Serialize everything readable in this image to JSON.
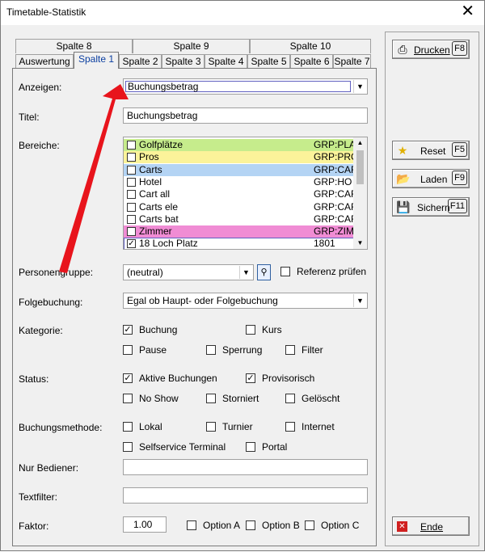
{
  "window": {
    "title": "Timetable-Statistik",
    "close_symbol": "✕"
  },
  "tabs_row1": [
    "Spalte 8",
    "Spalte 9",
    "Spalte 10"
  ],
  "tabs_row2": [
    "Auswertung",
    "Spalte 1",
    "Spalte 2",
    "Spalte 3",
    "Spalte 4",
    "Spalte 5",
    "Spalte 6",
    "Spalte 7"
  ],
  "form": {
    "anzeigen_label": "Anzeigen:",
    "anzeigen_value": "Buchungsbetrag",
    "titel_label": "Titel:",
    "titel_value": "Buchungsbetrag",
    "bereiche_label": "Bereiche:",
    "personengruppe_label": "Personengruppe:",
    "personengruppe_value": "(neutral)",
    "referenz_label": "Referenz prüfen",
    "folgebuchung_label": "Folgebuchung:",
    "folgebuchung_value": "Egal ob Haupt- oder Folgebuchung",
    "kategorie_label": "Kategorie:",
    "status_label": "Status:",
    "buchungsmethode_label": "Buchungsmethode:",
    "nur_bediener_label": "Nur Bediener:",
    "nur_bediener_value": "",
    "textfilter_label": "Textfilter:",
    "textfilter_value": "",
    "faktor_label": "Faktor:",
    "faktor_value": "1.00"
  },
  "bereiche": [
    {
      "name": "Golfplätze",
      "code": "GRP:PLA",
      "checked": false,
      "color": "#c6ec8c"
    },
    {
      "name": "Pros",
      "code": "GRP:PRO",
      "checked": false,
      "color": "#fbf39a"
    },
    {
      "name": "Carts",
      "code": "GRP:CAR",
      "checked": false,
      "color": "#b4d4f4"
    },
    {
      "name": "Hotel",
      "code": "GRP:HO",
      "checked": false,
      "color": "#ffffff"
    },
    {
      "name": "Cart all",
      "code": "GRP:CAR",
      "checked": false,
      "color": "#ffffff"
    },
    {
      "name": "Carts ele",
      "code": "GRP:CAR",
      "checked": false,
      "color": "#ffffff"
    },
    {
      "name": "Carts bat",
      "code": "GRP:CAR",
      "checked": false,
      "color": "#ffffff"
    },
    {
      "name": "Zimmer",
      "code": "GRP:ZIM",
      "checked": false,
      "color": "#f08cd4"
    },
    {
      "name": "18 Loch Platz",
      "code": "1801",
      "checked": true,
      "color": "#ffffff"
    }
  ],
  "kategorie": [
    {
      "label": "Buchung",
      "checked": true
    },
    {
      "label": "Kurs",
      "checked": false
    },
    {
      "label": "Pause",
      "checked": false
    },
    {
      "label": "Sperrung",
      "checked": false
    },
    {
      "label": "Filter",
      "checked": false
    }
  ],
  "status": [
    {
      "label": "Aktive Buchungen",
      "checked": true
    },
    {
      "label": "Provisorisch",
      "checked": true
    },
    {
      "label": "No Show",
      "checked": false
    },
    {
      "label": "Storniert",
      "checked": false
    },
    {
      "label": "Gelöscht",
      "checked": false
    }
  ],
  "methode": [
    {
      "label": "Lokal",
      "checked": false
    },
    {
      "label": "Turnier",
      "checked": false
    },
    {
      "label": "Internet",
      "checked": false
    },
    {
      "label": "Selfservice Terminal",
      "checked": false
    },
    {
      "label": "Portal",
      "checked": false
    }
  ],
  "options": [
    {
      "label": "Option A",
      "checked": false
    },
    {
      "label": "Option B",
      "checked": false
    },
    {
      "label": "Option C",
      "checked": false
    }
  ],
  "buttons": {
    "drucken": {
      "label": "Drucken",
      "key": "F8",
      "icon": "printer-icon"
    },
    "reset": {
      "label": "Reset",
      "key": "F5",
      "icon": "star-icon"
    },
    "laden": {
      "label": "Laden",
      "key": "F9",
      "icon": "folder-open-icon"
    },
    "sichern": {
      "label": "Sichern",
      "key": "F11",
      "icon": "floppy-disk-icon"
    },
    "ende": {
      "label": "Ende",
      "icon": "red-x-icon"
    }
  },
  "colors": {
    "annotation_arrow": "#e8141c",
    "focus_border": "#6060c0",
    "checkmark": "#1a1a1a"
  }
}
